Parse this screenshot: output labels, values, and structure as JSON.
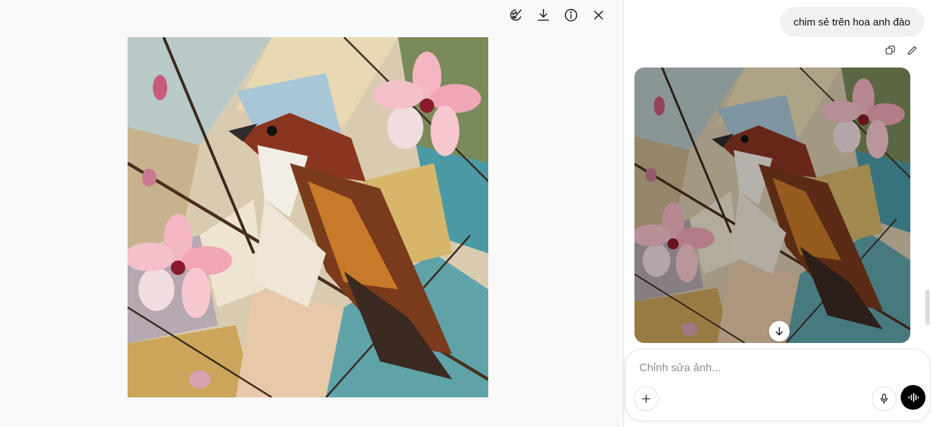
{
  "viewer": {
    "toolbar": [
      {
        "name": "edit-image-icon"
      },
      {
        "name": "download-icon"
      },
      {
        "name": "info-icon"
      },
      {
        "name": "close-icon"
      }
    ],
    "image_subject": "sparrow-on-cherry-blossom-cubist-painting"
  },
  "chat": {
    "user_message": "chim sẻ trên hoa anh đào",
    "message_actions": [
      "copy-icon",
      "edit-pencil-icon"
    ],
    "composer": {
      "placeholder": "Chỉnh sửa ảnh..."
    }
  },
  "colors": {
    "background": "#f9f9f9",
    "panel": "#ffffff",
    "bubble": "#f1f1f1",
    "voice_button": "#000000"
  }
}
